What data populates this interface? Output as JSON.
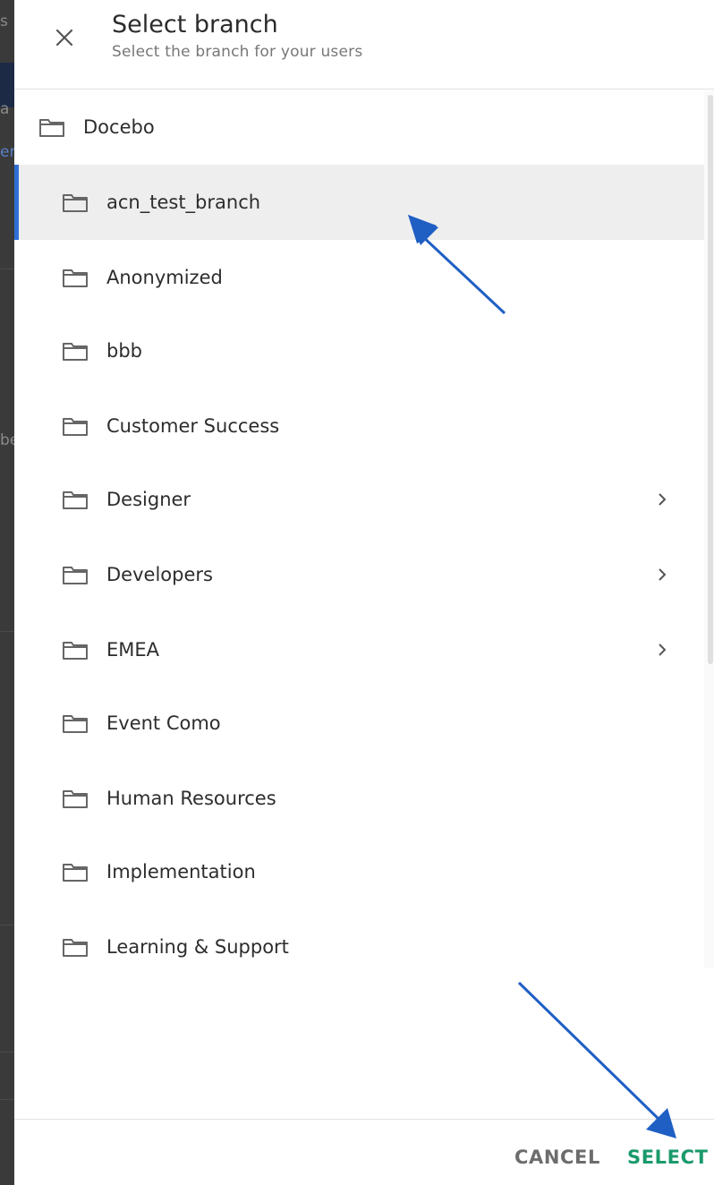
{
  "background_fragments": [
    "s",
    "a",
    "er",
    "be"
  ],
  "dialog": {
    "title": "Select branch",
    "subtitle": "Select the branch for your users"
  },
  "tree": {
    "root": {
      "label": "Docebo",
      "icon": "folder-icon"
    },
    "items": [
      {
        "label": "acn_test_branch",
        "icon": "folder-icon",
        "selected": true,
        "has_children": false
      },
      {
        "label": "Anonymized",
        "icon": "folder-icon",
        "selected": false,
        "has_children": false
      },
      {
        "label": "bbb",
        "icon": "folder-icon",
        "selected": false,
        "has_children": false
      },
      {
        "label": "Customer Success",
        "icon": "folder-icon",
        "selected": false,
        "has_children": false
      },
      {
        "label": "Designer",
        "icon": "folder-icon",
        "selected": false,
        "has_children": true
      },
      {
        "label": "Developers",
        "icon": "folder-icon",
        "selected": false,
        "has_children": true
      },
      {
        "label": "EMEA",
        "icon": "folder-icon",
        "selected": false,
        "has_children": true
      },
      {
        "label": "Event Como",
        "icon": "folder-icon",
        "selected": false,
        "has_children": false
      },
      {
        "label": "Human Resources",
        "icon": "folder-icon",
        "selected": false,
        "has_children": false
      },
      {
        "label": "Implementation",
        "icon": "folder-icon",
        "selected": false,
        "has_children": false
      },
      {
        "label": "Learning & Support",
        "icon": "folder-icon",
        "selected": false,
        "has_children": false
      }
    ]
  },
  "footer": {
    "cancel_label": "CANCEL",
    "select_label": "SELECT"
  },
  "colors": {
    "selected_accent": "#2f6fd6",
    "select_button": "#1a9a6b",
    "annotation_arrow": "#1f5fc4"
  }
}
